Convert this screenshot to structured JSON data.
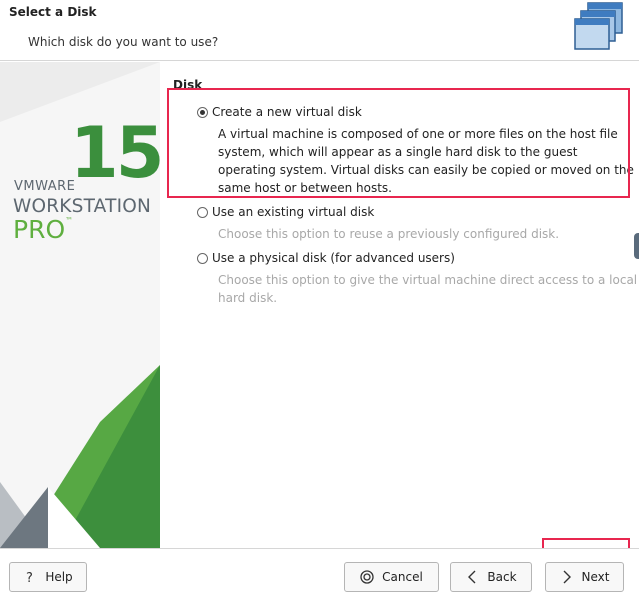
{
  "header": {
    "title": "Select a Disk",
    "subtitle": "Which disk do you want to use?"
  },
  "banner": {
    "brand": "VMWARE",
    "version": "15",
    "product": "WORKSTATION",
    "edition": "PRO",
    "trademark": "™",
    "colors": {
      "green": "#3b8f3d",
      "gray": "#5d6770"
    }
  },
  "content": {
    "group_label": "Disk",
    "options": [
      {
        "label": "Create a new virtual disk",
        "selected": true,
        "description": "A virtual machine is composed of one or more files on the host file system, which will appear as a single hard disk to the guest operating system. Virtual disks can easily be copied or moved on the same host or between hosts."
      },
      {
        "label": "Use an existing virtual disk",
        "selected": false,
        "description": "Choose this option to reuse a previously configured disk."
      },
      {
        "label": "Use a physical disk (for advanced users)",
        "selected": false,
        "description": "Choose this option to give the virtual machine direct access to a local hard disk."
      }
    ]
  },
  "footer": {
    "help_label": "Help",
    "cancel_label": "Cancel",
    "back_label": "Back",
    "next_label": "Next"
  },
  "annotation_color": "#e8264f"
}
